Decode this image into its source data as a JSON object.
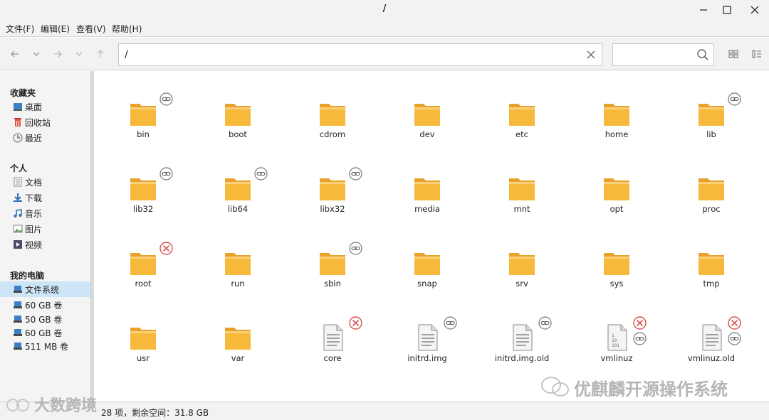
{
  "window": {
    "title": "/"
  },
  "menu": [
    "文件(F)",
    "编辑(E)",
    "查看(V)",
    "帮助(H)"
  ],
  "path": {
    "value": "/"
  },
  "search": {
    "value": ""
  },
  "sidebar": {
    "favorites_heading": "收藏夹",
    "favorites": [
      {
        "label": "桌面",
        "icon": "desktop-icon"
      },
      {
        "label": "回收站",
        "icon": "trash-icon"
      },
      {
        "label": "最近",
        "icon": "recent-icon"
      }
    ],
    "personal_heading": "个人",
    "personal": [
      {
        "label": "文档",
        "icon": "documents-icon"
      },
      {
        "label": "下载",
        "icon": "download-icon"
      },
      {
        "label": "音乐",
        "icon": "music-icon"
      },
      {
        "label": "图片",
        "icon": "pictures-icon"
      },
      {
        "label": "视频",
        "icon": "video-icon"
      }
    ],
    "computer_heading": "我的电脑",
    "computer": [
      {
        "label": "文件系统",
        "icon": "drive-icon",
        "selected": true
      },
      {
        "label": "60 GB 卷",
        "icon": "drive-icon"
      },
      {
        "label": "50 GB 卷",
        "icon": "drive-icon"
      },
      {
        "label": "60 GB 卷",
        "icon": "drive-icon"
      },
      {
        "label": "511 MB 卷",
        "icon": "drive-icon"
      }
    ]
  },
  "files": [
    {
      "name": "bin",
      "type": "folder",
      "emblem": "link"
    },
    {
      "name": "boot",
      "type": "folder",
      "emblem": ""
    },
    {
      "name": "cdrom",
      "type": "folder",
      "emblem": ""
    },
    {
      "name": "dev",
      "type": "folder",
      "emblem": ""
    },
    {
      "name": "etc",
      "type": "folder",
      "emblem": ""
    },
    {
      "name": "home",
      "type": "folder",
      "emblem": ""
    },
    {
      "name": "lib",
      "type": "folder",
      "emblem": "link"
    },
    {
      "name": "lib32",
      "type": "folder",
      "emblem": "link"
    },
    {
      "name": "lib64",
      "type": "folder",
      "emblem": "link"
    },
    {
      "name": "libx32",
      "type": "folder",
      "emblem": "link"
    },
    {
      "name": "media",
      "type": "folder",
      "emblem": ""
    },
    {
      "name": "mnt",
      "type": "folder",
      "emblem": ""
    },
    {
      "name": "opt",
      "type": "folder",
      "emblem": ""
    },
    {
      "name": "proc",
      "type": "folder",
      "emblem": ""
    },
    {
      "name": "root",
      "type": "folder",
      "emblem": "noaccess"
    },
    {
      "name": "run",
      "type": "folder",
      "emblem": ""
    },
    {
      "name": "sbin",
      "type": "folder",
      "emblem": "link"
    },
    {
      "name": "snap",
      "type": "folder",
      "emblem": ""
    },
    {
      "name": "srv",
      "type": "folder",
      "emblem": ""
    },
    {
      "name": "sys",
      "type": "folder",
      "emblem": ""
    },
    {
      "name": "tmp",
      "type": "folder",
      "emblem": ""
    },
    {
      "name": "usr",
      "type": "folder",
      "emblem": ""
    },
    {
      "name": "var",
      "type": "folder",
      "emblem": ""
    },
    {
      "name": "core",
      "type": "doc",
      "emblem": "noaccess"
    },
    {
      "name": "initrd.img",
      "type": "doc",
      "emblem": "link"
    },
    {
      "name": "initrd.img.old",
      "type": "doc",
      "emblem": "link"
    },
    {
      "name": "vmlinuz",
      "type": "binary",
      "emblem": "both"
    },
    {
      "name": "vmlinuz.old",
      "type": "doc",
      "emblem": "both"
    }
  ],
  "status": "28 项，剩余空间：31.8 GB",
  "watermarks": {
    "left": "大数跨境",
    "right": "优麒麟开源操作系统"
  },
  "colors": {
    "folder": "#f6b93b",
    "folder_tab": "#e8a22c",
    "selected": "#cde6f7"
  }
}
